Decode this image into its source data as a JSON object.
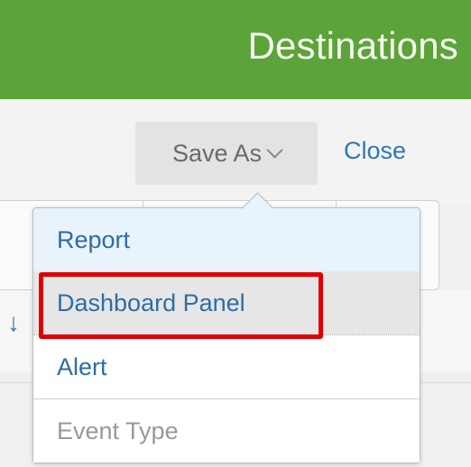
{
  "header": {
    "title": "Destinations",
    "background_color": "#5ca33a"
  },
  "toolbar": {
    "save_as_label": "Save As",
    "save_as_icon": "chevron-down-icon",
    "close_label": "Close"
  },
  "background": {
    "partial_icon": "down-arrow-icon",
    "partial_icon_glyph": "↓"
  },
  "menu": {
    "items": [
      {
        "label": "Report",
        "state": "hover"
      },
      {
        "label": "Dashboard Panel",
        "state": "highlighted"
      },
      {
        "label": "Alert",
        "state": "normal"
      },
      {
        "label": "Event Type",
        "state": "disabled"
      }
    ]
  },
  "annotation": {
    "highlight_color": "#e00000",
    "highlighted_item": "Dashboard Panel"
  }
}
